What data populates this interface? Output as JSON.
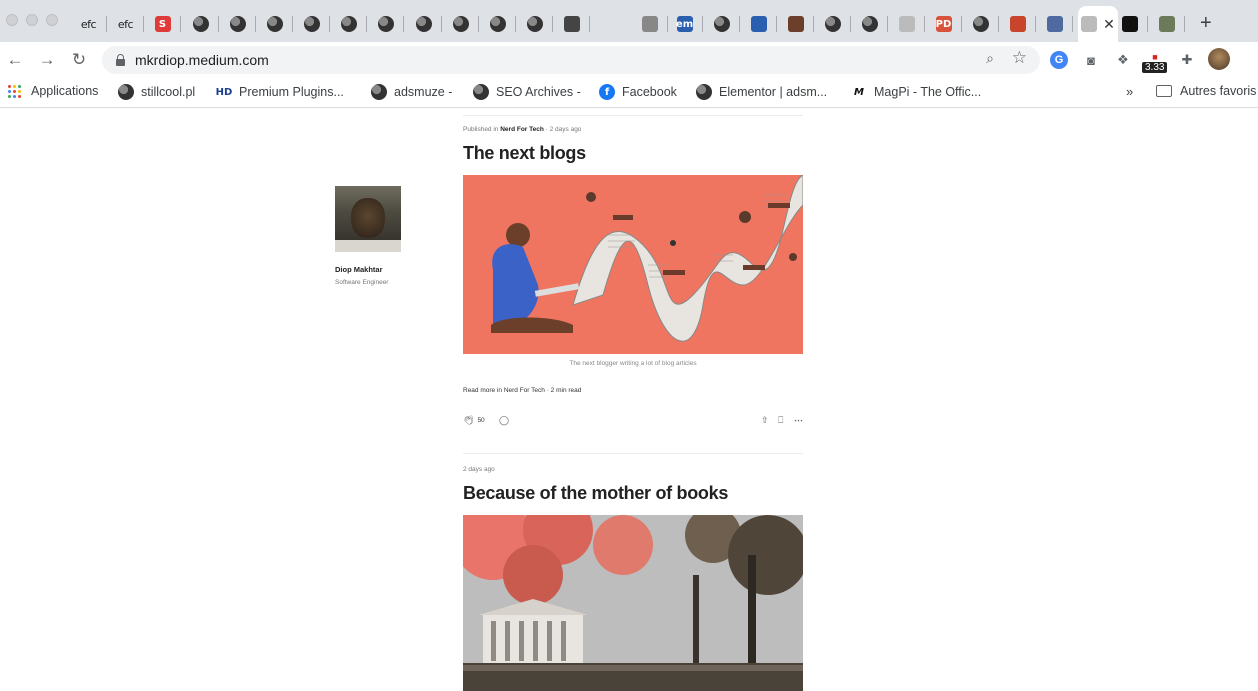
{
  "browser": {
    "tabs": [
      {
        "icon": "efc-icon",
        "label": "efc"
      },
      {
        "icon": "efc-icon",
        "label": "efc"
      },
      {
        "icon": "s-logo-icon",
        "label": "S"
      },
      {
        "icon": "globe-icon"
      },
      {
        "icon": "globe-icon"
      },
      {
        "icon": "globe-icon"
      },
      {
        "icon": "globe-icon"
      },
      {
        "icon": "globe-icon"
      },
      {
        "icon": "globe-icon"
      },
      {
        "icon": "globe-icon"
      },
      {
        "icon": "globe-icon"
      },
      {
        "icon": "globe-icon"
      },
      {
        "icon": "globe-icon"
      },
      {
        "icon": "museum-icon"
      },
      {
        "icon": "logo-t-icon"
      },
      {
        "icon": "em-logo-icon",
        "label": "em"
      },
      {
        "icon": "globe-icon"
      },
      {
        "icon": "people-icon"
      },
      {
        "icon": "square-logo-icon"
      },
      {
        "icon": "globe-icon"
      },
      {
        "icon": "globe-icon"
      },
      {
        "icon": "cloud-icon"
      },
      {
        "icon": "pd-logo-icon",
        "label": "PD"
      },
      {
        "icon": "globe-icon"
      },
      {
        "icon": "figure-icon"
      },
      {
        "icon": "trident-icon"
      },
      {
        "icon": "medium-icon",
        "active": true
      },
      {
        "icon": "medium-logo-icon"
      },
      {
        "icon": "tree-icon"
      }
    ],
    "url": "mkrdiop.medium.com",
    "extension_badge": "3.33",
    "bookmarks": [
      {
        "label": "Applications",
        "icon": "apps-grid-icon"
      },
      {
        "label": "stillcool.pl",
        "icon": "globe-icon"
      },
      {
        "label": "Premium Plugins...",
        "icon": "hd-icon",
        "icon_text": "HD"
      },
      {
        "label": "adsmuze -",
        "icon": "globe-icon"
      },
      {
        "label": "SEO Archives -",
        "icon": "globe-icon"
      },
      {
        "label": "Facebook",
        "icon": "facebook-icon",
        "icon_text": "f"
      },
      {
        "label": "Elementor | adsm...",
        "icon": "globe-icon"
      },
      {
        "label": "MagPi - The Offic...",
        "icon": "magpi-icon",
        "icon_text": "M"
      }
    ],
    "bookmarks_overflow": "»",
    "other_bookmarks": "Autres favoris"
  },
  "profile": {
    "name": "Diop Makhtar",
    "role": "Software Engineer"
  },
  "posts": [
    {
      "meta_prefix": "Published in",
      "publication": "Nerd For Tech",
      "sep": "·",
      "date": "2 days ago",
      "title": "The next blogs",
      "caption": "The next blogger writing a lot of blog articles",
      "read_more": "Read more in Nerd For Tech · 2 min read",
      "claps": "50"
    },
    {
      "date": "2 days ago",
      "title": "Because of the mother of books"
    }
  ],
  "colors": {
    "hero_bg": "#f07560",
    "tab_strip": "#dee1e6",
    "omnibox": "#f1f3f4"
  }
}
